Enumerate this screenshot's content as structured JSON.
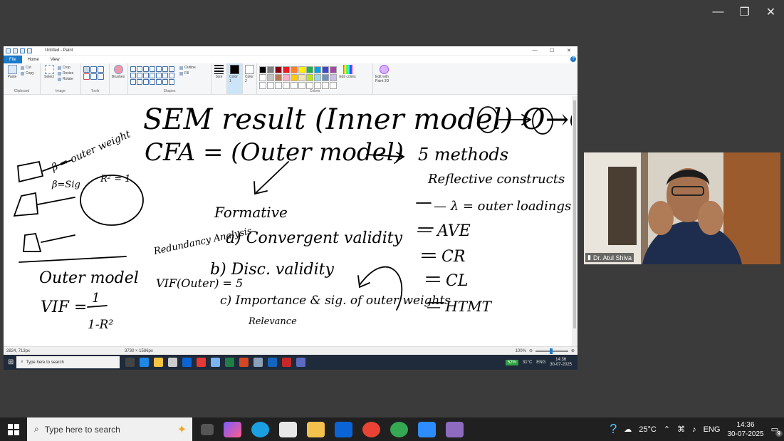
{
  "meeting": {
    "presenter_name": "Dr. Atul Shiva",
    "window_controls": {
      "minimize": "—",
      "restore": "❐",
      "close": "✕"
    }
  },
  "paint": {
    "title": "Untitled - Paint",
    "window_controls": {
      "minimize": "—",
      "maximize": "☐",
      "close": "✕"
    },
    "tabs": [
      "File",
      "Home",
      "View"
    ],
    "help_label": "?",
    "ribbon": {
      "clipboard": {
        "paste": "Paste",
        "cut": "Cut",
        "copy": "Copy",
        "label": "Clipboard"
      },
      "image": {
        "select": "Select",
        "crop": "Crop",
        "resize": "Resize",
        "rotate": "Rotate",
        "label": "Image"
      },
      "tools": {
        "label": "Tools"
      },
      "brushes": {
        "label": "Brushes"
      },
      "shapes": {
        "outline": "Outline",
        "fill": "Fill",
        "label": "Shapes"
      },
      "size": {
        "label": "Size"
      },
      "color1": {
        "label": "Color 1"
      },
      "color2": {
        "label": "Color 2"
      },
      "colors": {
        "edit": "Edit colors",
        "paint3d": "Edit with Paint 3D",
        "label": "Colors"
      }
    },
    "palette": [
      "#000000",
      "#7f7f7f",
      "#880015",
      "#ed1c24",
      "#ff7f27",
      "#fff200",
      "#22b14c",
      "#00a2e8",
      "#3f48cc",
      "#a349a4",
      "#ffffff",
      "#c3c3c3",
      "#b97a57",
      "#ffaec9",
      "#ffc90e",
      "#efe4b0",
      "#b5e61d",
      "#99d9ea",
      "#7092be",
      "#c8bfe7",
      "#ffffff",
      "#ffffff",
      "#ffffff",
      "#ffffff",
      "#ffffff",
      "#ffffff",
      "#ffffff",
      "#ffffff",
      "#ffffff",
      "#ffffff"
    ],
    "status": {
      "cursor_pos": "2824, 713px",
      "canvas_size": "3730 × 1586px",
      "zoom": "100%"
    }
  },
  "inner_taskbar": {
    "search_placeholder": "Type here to search",
    "battery": "52%",
    "weather": "31°C",
    "lang": "ENG",
    "time": "14:36",
    "date": "30-07-2025"
  },
  "taskbar": {
    "search_placeholder": "Type here to search",
    "weather": "25°C",
    "lang": "ENG",
    "time": "14:36",
    "date": "30-07-2025",
    "notifications": "9"
  },
  "whiteboard": {
    "title_line": "SEM result (Inner model) O→O",
    "cfa_line": "CFA = (Outer model)",
    "methods": "5 methods",
    "reflective": "Reflective constructs",
    "formative": "Formative",
    "outer_weight_note": "β ⇒ outer weight",
    "beta_sig": "β=Sig",
    "r_squared": "R² = 1",
    "reflective_items": [
      "— λ = outer loadings",
      "— AVE",
      "— CR",
      "— CL",
      "— HTMT"
    ],
    "formative_items": [
      "a) Convergent validity",
      "b) Disc. validity",
      "c) Importance & sig. of outer weights"
    ],
    "redundancy": "Redundancy Analysis",
    "relevance": "Relevance",
    "vif_outer": "VIF(Outer) = 5",
    "outer_model": "Outer model",
    "vif_formula_left": "VIF =",
    "vif_formula_num": "1",
    "vif_formula_den": "1-R²"
  }
}
